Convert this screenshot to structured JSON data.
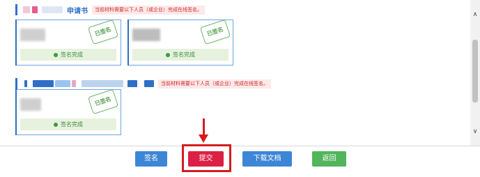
{
  "section1": {
    "title": "申请书",
    "notice": "当前材料需要以下人员（或企业）完成在线签名。",
    "cards": [
      {
        "stamp": "已签名",
        "status": "签名完成"
      },
      {
        "stamp": "已签名",
        "status": "签名完成"
      }
    ]
  },
  "section2": {
    "notice": "当前材料需要以下人员（或企业）完成在线签名。",
    "cards": [
      {
        "stamp": "已签名",
        "status": "签名完成"
      }
    ]
  },
  "buttons": {
    "sign": "签名",
    "submit": "提交",
    "download": "下载文档",
    "back": "返回"
  },
  "icons": {
    "scroll_up": "chevron-up-icon",
    "scroll_down": "chevron-down-icon",
    "status_ok": "check-circle-icon",
    "annotation_arrow": "arrow-down-icon"
  },
  "colors": {
    "accent_blue": "#3d86d6",
    "submit_red": "#dc1f44",
    "back_green": "#52b55c",
    "notice_red": "#d02a2a",
    "annotation_red": "#d41c1c"
  }
}
